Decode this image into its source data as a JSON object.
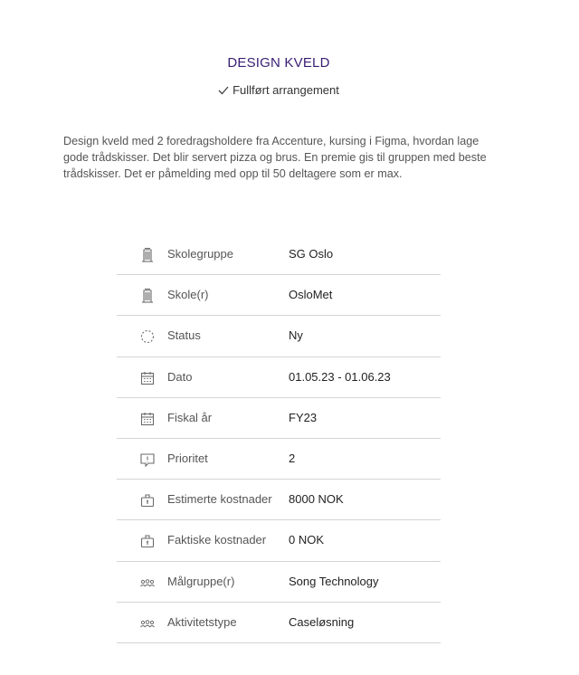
{
  "event": {
    "title": "DESIGN KVELD",
    "status_text": "Fullført arrangement",
    "description": "Design kveld med 2 foredragsholdere fra Accenture, kursing i Figma, hvordan lage gode trådskisser. Det blir servert pizza og brus. En premie gis til gruppen med beste trådskisser. Det er påmelding med opp til 50 deltagere som er max."
  },
  "details": [
    {
      "icon": "building-icon",
      "label": "Skolegruppe",
      "value": "SG Oslo"
    },
    {
      "icon": "building-icon",
      "label": "Skole(r)",
      "value": "OsloMet"
    },
    {
      "icon": "loading-icon",
      "label": "Status",
      "value": "Ny"
    },
    {
      "icon": "calendar-icon",
      "label": "Dato",
      "value": "01.05.23 - 01.06.23"
    },
    {
      "icon": "calendar-icon",
      "label": "Fiskal år",
      "value": "FY23"
    },
    {
      "icon": "comment-alert-icon",
      "label": "Prioritet",
      "value": "2"
    },
    {
      "icon": "money-bag-icon",
      "label": "Estimerte kostnader",
      "value": "8000 NOK"
    },
    {
      "icon": "money-bag-icon",
      "label": "Faktiske kostnader",
      "value": "0 NOK"
    },
    {
      "icon": "group-icon",
      "label": "Målgruppe(r)",
      "value": "Song Technology"
    },
    {
      "icon": "group-icon",
      "label": "Aktivitetstype",
      "value": "Caseløsning"
    }
  ],
  "colors": {
    "title": "#3a1e74",
    "icon": "#6b6b6b",
    "divider": "#d4d4d4"
  }
}
